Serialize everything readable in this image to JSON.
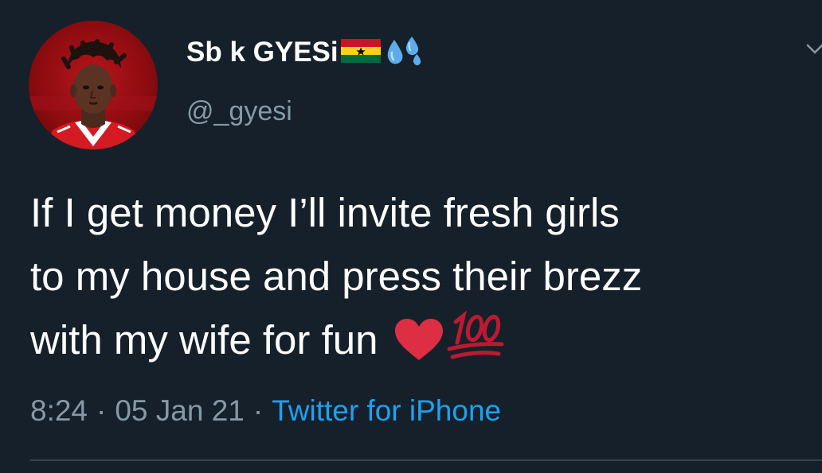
{
  "tweet": {
    "author": {
      "display_name": "Sb k GYESi",
      "handle": "@_gyesi",
      "name_emojis": [
        "ghana-flag-icon",
        "sweat-droplets-icon"
      ]
    },
    "text_lines": [
      "If I get money I’ll invite fresh girls",
      "to my house and press their brezz",
      "with my wife for fun"
    ],
    "text_emojis": [
      "red-heart-icon",
      "hundred-points-icon"
    ],
    "time": "8:24",
    "date": "05 Jan 21",
    "separator": "·",
    "source": "Twitter for iPhone"
  },
  "colors": {
    "background": "#15202b",
    "text": "#ffffff",
    "secondary_text": "#8899a6",
    "link": "#1da1f2",
    "divider": "#38444d"
  }
}
